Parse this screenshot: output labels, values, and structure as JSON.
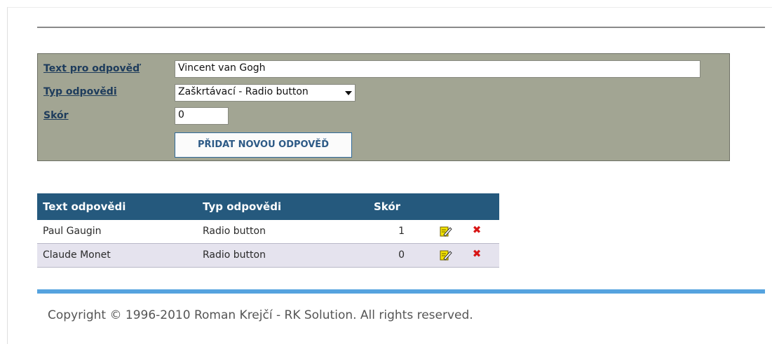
{
  "form": {
    "text_label": "Text pro odpověď",
    "text_value": "Vincent van Gogh",
    "type_label": "Typ odpovědi",
    "type_value": "Zaškrtávací - Radio button",
    "score_label": "Skór",
    "score_value": "0",
    "add_button": "PŘIDAT NOVOU ODPOVĚĎ"
  },
  "answers": {
    "headers": [
      "Text odpovědi",
      "Typ odpovědi",
      "Skór"
    ],
    "rows": [
      {
        "text": "Paul Gaugin",
        "type": "Radio button",
        "score": "1"
      },
      {
        "text": "Claude Monet",
        "type": "Radio button",
        "score": "0"
      }
    ],
    "edit_icon": "edit-icon",
    "delete_icon": "delete-icon"
  },
  "footer": {
    "copyright": "Copyright © 1996-2010 Roman Krejčí - RK Solution. All rights reserved."
  },
  "colors": {
    "form_background": "#a2a593",
    "header_background": "#25597d",
    "alt_row": "#e5e3ee",
    "footer_rule": "#55a3df",
    "delete": "#d81616"
  }
}
